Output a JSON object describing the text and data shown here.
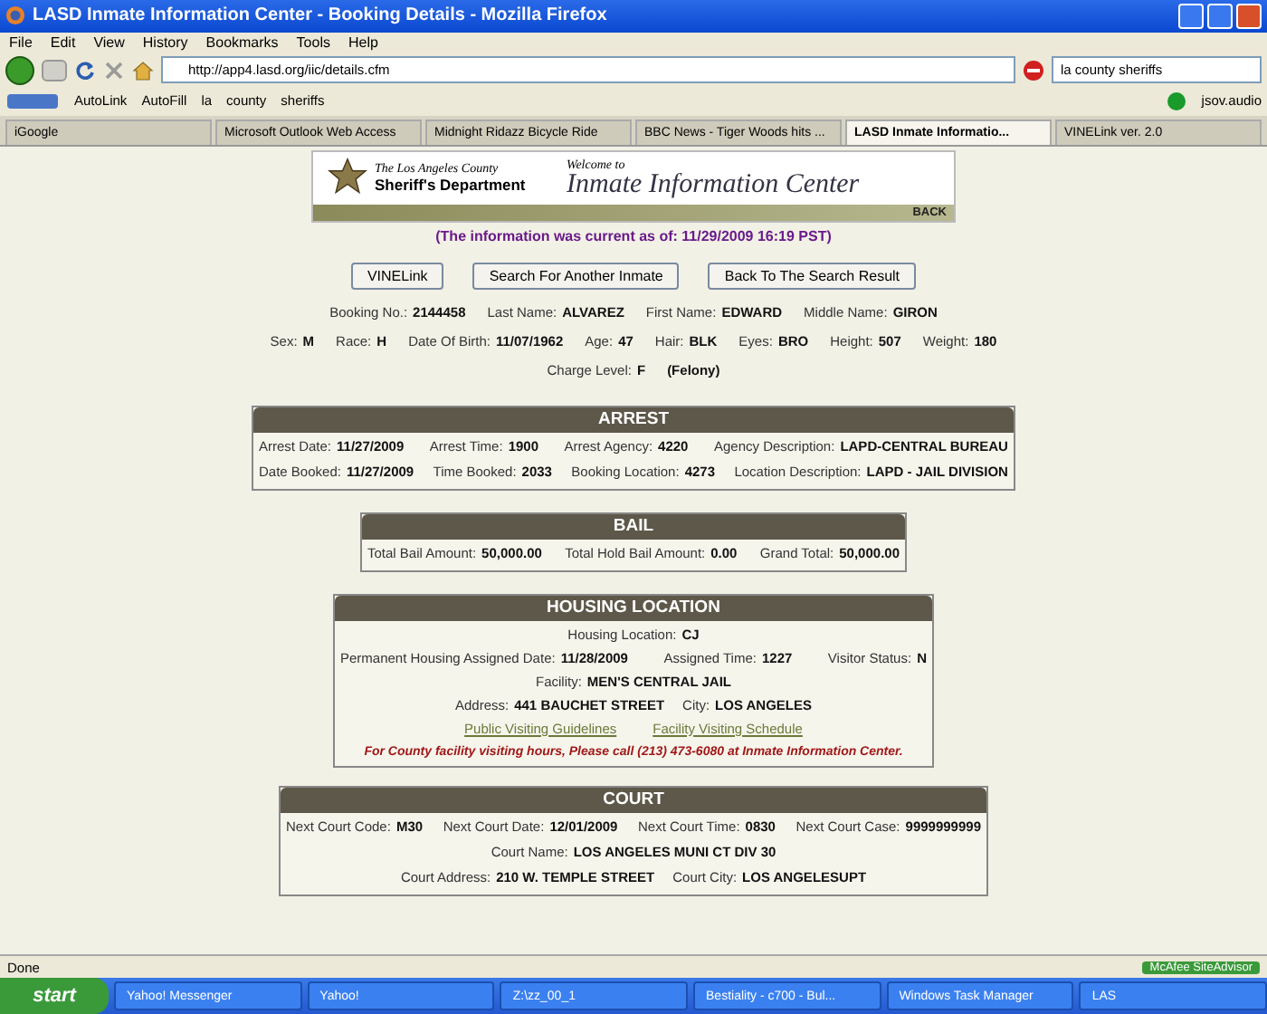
{
  "window": {
    "title": "LASD Inmate Information Center - Booking Details - Mozilla Firefox"
  },
  "menu": [
    "File",
    "Edit",
    "View",
    "History",
    "Bookmarks",
    "Tools",
    "Help"
  ],
  "nav": {
    "url": "http://app4.lasd.org/iic/details.cfm",
    "search": "la county sheriffs"
  },
  "bookmarks": [
    "AutoLink",
    "AutoFill",
    "la",
    "county",
    "sheriffs"
  ],
  "bookmarks_right": "jsov.audio",
  "tabs": [
    {
      "label": "iGoogle",
      "selected": false
    },
    {
      "label": "Microsoft Outlook Web Access",
      "selected": false
    },
    {
      "label": "Midnight Ridazz Bicycle Ride",
      "selected": false
    },
    {
      "label": "BBC News - Tiger Woods hits ...",
      "selected": false
    },
    {
      "label": "LASD Inmate Informatio...",
      "selected": true
    },
    {
      "label": "VINELink ver. 2.0",
      "selected": false
    }
  ],
  "banner": {
    "agency_top": "The Los Angeles County",
    "agency": "Sheriff's Department",
    "welcome": "Welcome to",
    "title": "Inmate Information Center",
    "back": "BACK"
  },
  "info_line": "(The information was current as of: 11/29/2009 16:19 PST)",
  "buttons": [
    "VINELink",
    "Search For Another Inmate",
    "Back To The Search Result"
  ],
  "person_rows": [
    [
      {
        "label": "Booking No.:",
        "value": "2144458"
      },
      {
        "label": "Last Name:",
        "value": "ALVAREZ"
      },
      {
        "label": "First Name:",
        "value": "EDWARD"
      },
      {
        "label": "Middle Name:",
        "value": "GIRON"
      }
    ],
    [
      {
        "label": "Sex:",
        "value": "M"
      },
      {
        "label": "Race:",
        "value": "H"
      },
      {
        "label": "Date Of Birth:",
        "value": "11/07/1962"
      },
      {
        "label": "Age:",
        "value": "47"
      },
      {
        "label": "Hair:",
        "value": "BLK"
      },
      {
        "label": "Eyes:",
        "value": "BRO"
      },
      {
        "label": "Height:",
        "value": "507"
      },
      {
        "label": "Weight:",
        "value": "180"
      }
    ],
    [
      {
        "label": "Charge Level:",
        "value": "F"
      },
      {
        "value": "(Felony)"
      }
    ]
  ],
  "sections": [
    {
      "title": "ARREST",
      "kind": "arrest",
      "lines": [
        {
          "fields": [
            {
              "label": "Arrest Date:",
              "value": "11/27/2009"
            },
            {
              "label": "Arrest Time:",
              "value": "1900"
            },
            {
              "label": "Arrest Agency:",
              "value": "4220"
            },
            {
              "label": "Agency Description:",
              "value": "LAPD-CENTRAL BUREAU"
            }
          ]
        },
        {
          "fields": [
            {
              "label": "Date Booked:",
              "value": "11/27/2009"
            },
            {
              "label": "Time Booked:",
              "value": "2033"
            },
            {
              "label": "Booking Location:",
              "value": "4273"
            },
            {
              "label": "Location Description:",
              "value": "LAPD - JAIL DIVISION"
            }
          ]
        }
      ]
    },
    {
      "title": "BAIL",
      "kind": "bail",
      "lines": [
        {
          "fields": [
            {
              "label": "Total Bail Amount:",
              "value": "50,000.00"
            },
            {
              "label": "Total Hold Bail Amount:",
              "value": "0.00"
            },
            {
              "label": "Grand Total:",
              "value": "50,000.00"
            }
          ]
        }
      ]
    },
    {
      "title": "HOUSING LOCATION",
      "kind": "housing",
      "lines": [
        {
          "fields": [
            {
              "label": "Housing Location:",
              "value": "CJ"
            }
          ]
        },
        {
          "fields": [
            {
              "label": "Permanent Housing Assigned Date:",
              "value": "11/28/2009"
            },
            {
              "label": "Assigned Time:",
              "value": "1227"
            },
            {
              "label": "Visitor Status:",
              "value": "N"
            }
          ]
        },
        {
          "fields": [
            {
              "label": "Facility:",
              "value": "MEN'S CENTRAL JAIL"
            }
          ]
        },
        {
          "fields": [
            {
              "label": "Address:",
              "value": "441 BAUCHET STREET"
            },
            {
              "label": "City:",
              "value": "LOS ANGELES"
            }
          ]
        }
      ],
      "links": [
        "Public Visiting Guidelines",
        "Facility Visiting Schedule"
      ],
      "notice": "For County facility visiting hours, Please call (213) 473-6080 at Inmate Information Center."
    },
    {
      "title": "COURT",
      "kind": "court",
      "lines": [
        {
          "fields": [
            {
              "label": "Next Court Code:",
              "value": "M30"
            },
            {
              "label": "Next Court Date:",
              "value": "12/01/2009"
            },
            {
              "label": "Next Court Time:",
              "value": "0830"
            },
            {
              "label": "Next Court Case:",
              "value": "9999999999"
            }
          ]
        },
        {
          "fields": [
            {
              "label": "Court Name:",
              "value": "LOS ANGELES MUNI CT DIV 30"
            }
          ]
        },
        {
          "fields": [
            {
              "label": "Court Address:",
              "value": "210 W. TEMPLE STREET"
            },
            {
              "label": "Court City:",
              "value": "LOS ANGELESUPT"
            }
          ]
        }
      ]
    }
  ],
  "status_bar": {
    "text": "Done",
    "addon": "McAfee SiteAdvisor"
  },
  "taskbar": {
    "start": "start",
    "items": [
      "Yahoo! Messenger",
      "Yahoo!",
      "Z:\\zz_00_1",
      "Bestiality - c700 - Bul...",
      "Windows Task Manager",
      "LAS"
    ]
  }
}
